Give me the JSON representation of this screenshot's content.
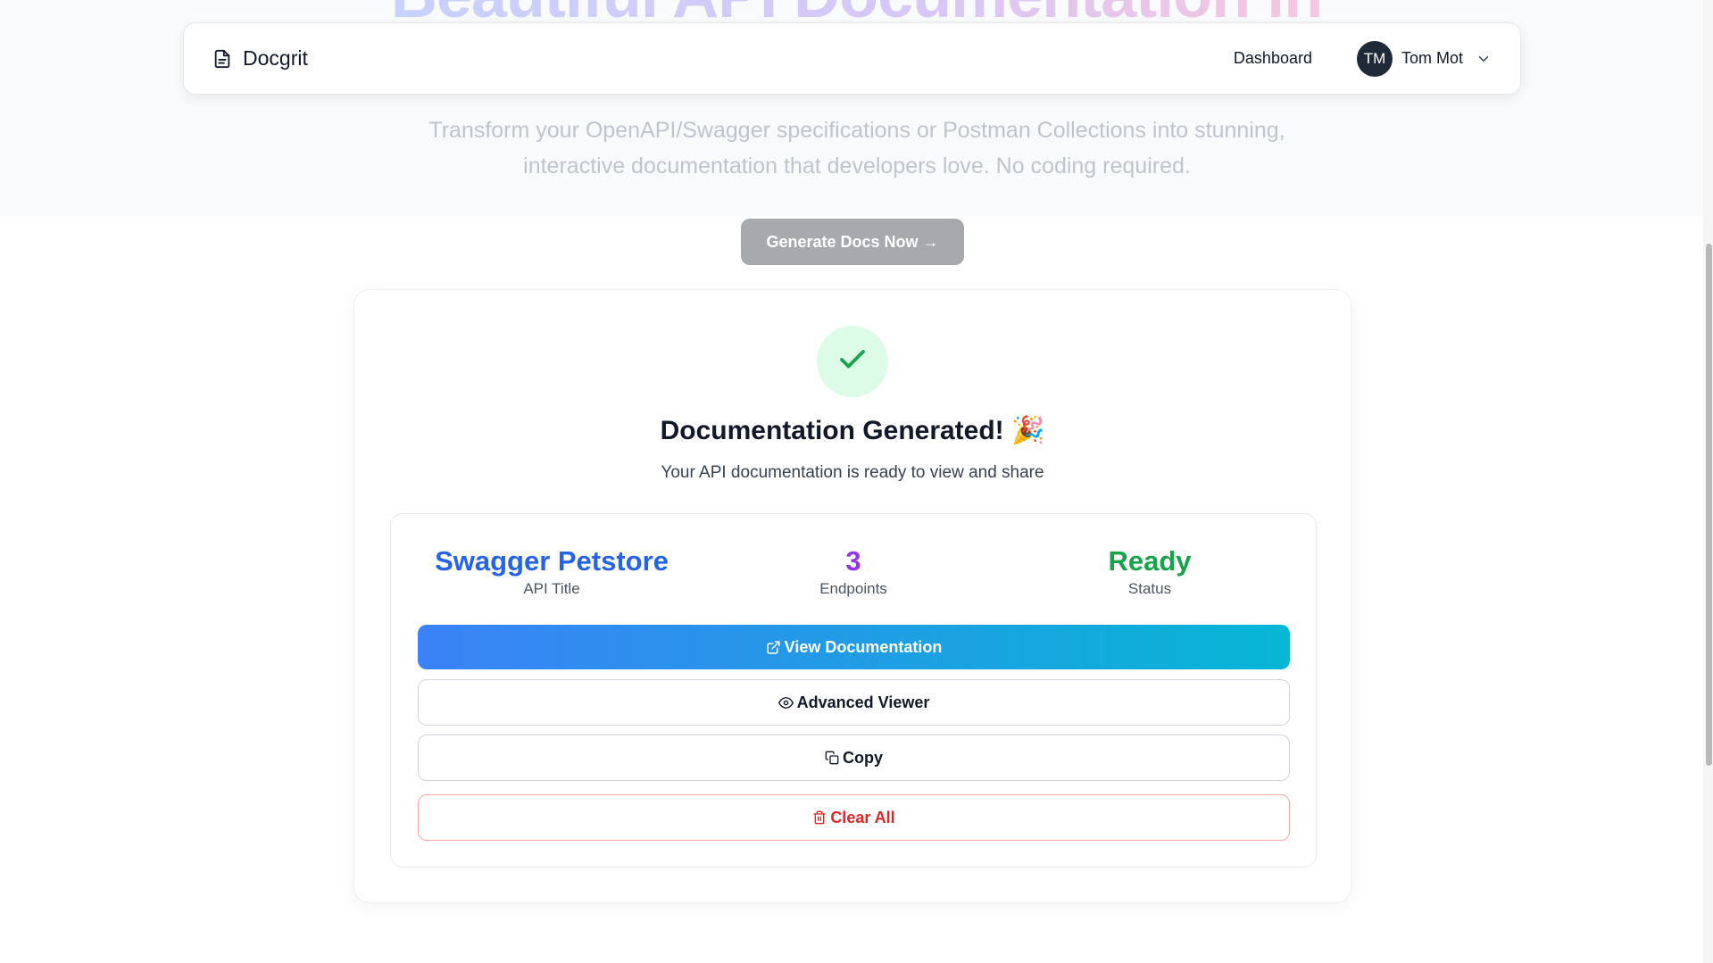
{
  "hero": {
    "title": "Beautiful API Documentation in",
    "subtitle": "Transform your OpenAPI/Swagger specifications or Postman Collections into stunning, interactive documentation that developers love. No coding required."
  },
  "navbar": {
    "brand": "Docgrit",
    "dashboard_link": "Dashboard",
    "user": {
      "initials": "TM",
      "name": "Tom Mot"
    }
  },
  "generate_button": "Generate Docs Now →",
  "result": {
    "title": "Documentation Generated! 🎉",
    "subtitle": "Your API documentation is ready to view and share",
    "stats": [
      {
        "value": "Swagger Petstore",
        "label": "API Title",
        "color": "#2563eb"
      },
      {
        "value": "3",
        "label": "Endpoints",
        "color": "#9333ea"
      },
      {
        "value": "Ready",
        "label": "Status",
        "color": "#16a34a"
      }
    ],
    "actions": {
      "view": "View Documentation",
      "advanced": "Advanced Viewer",
      "copy": "Copy",
      "clear": "Clear All"
    }
  },
  "colors": {
    "primary_gradient_start": "#3b82f6",
    "primary_gradient_end": "#06b6d4",
    "success": "#16a34a",
    "danger": "#dc2626"
  },
  "icons": {
    "brand": "file-text-icon",
    "chevron": "chevron-down-icon",
    "success": "check-icon",
    "view": "external-link-icon",
    "advanced": "eye-icon",
    "copy": "copy-icon",
    "clear": "trash-icon"
  }
}
